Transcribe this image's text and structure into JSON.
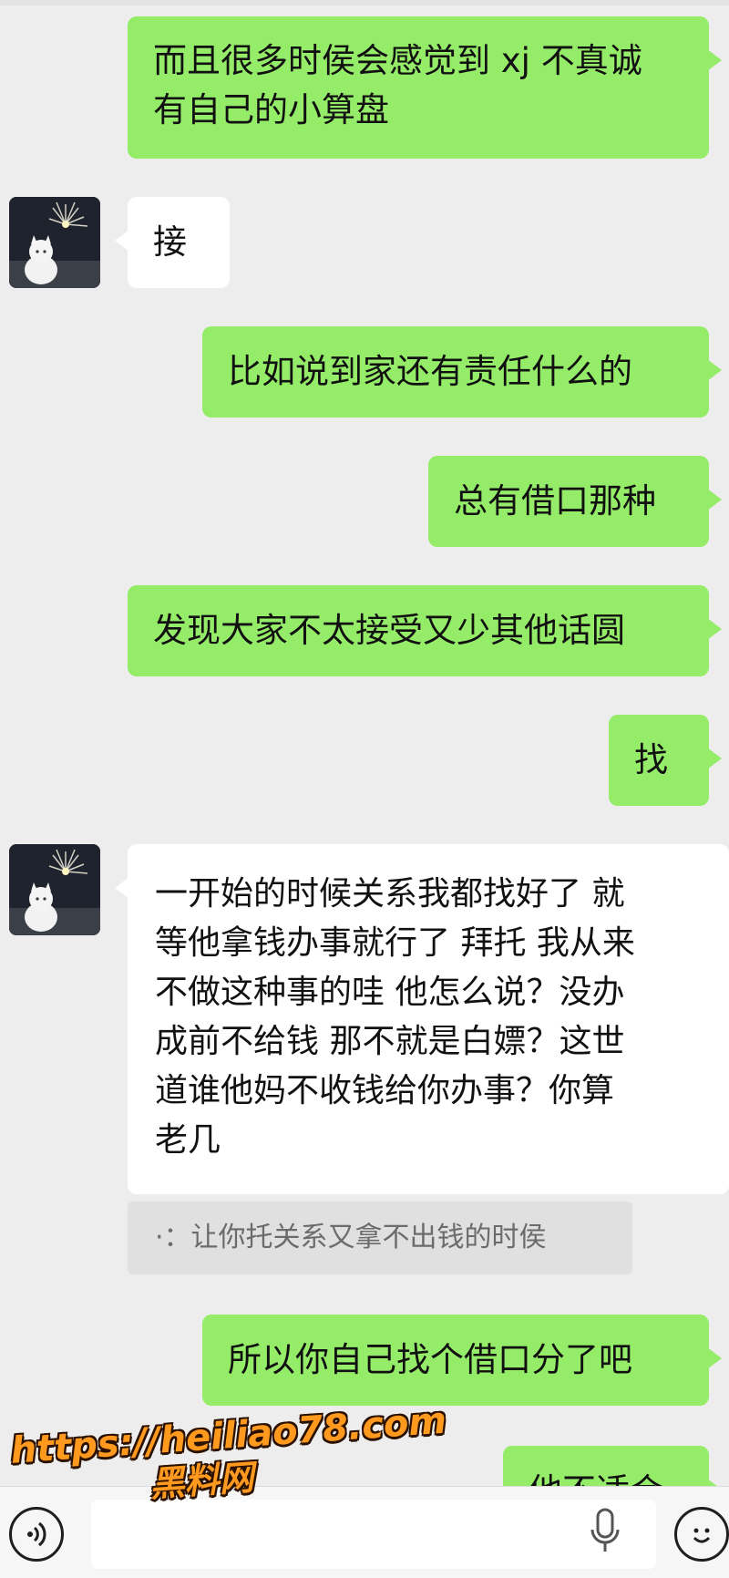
{
  "messages": [
    {
      "side": "me",
      "text": "而且很多时侯会感觉到 xj 不真诚\n有自己的小算盘"
    },
    {
      "side": "them",
      "text": "接"
    },
    {
      "side": "me",
      "text": "比如说到家还有责任什么的"
    },
    {
      "side": "me",
      "text": "总有借口那种"
    },
    {
      "side": "me",
      "text": "发现大家不太接受又少其他话圆"
    },
    {
      "side": "me",
      "text": "找"
    },
    {
      "side": "them",
      "text": "一开始的时候关系我都找好了 就\n等他拿钱办事就行了 拜托 我从来\n不做这种事的哇 他怎么说？没办\n成前不给钱 那不就是白嫖？这世\n道谁他妈不收钱给你办事？你算\n老几"
    },
    {
      "side": "quote",
      "text": "·：让你托关系又拿不出钱的时侯"
    },
    {
      "side": "me",
      "text": "所以你自己找个借口分了吧"
    },
    {
      "side": "me",
      "text": "他不适合"
    }
  ],
  "watermark": {
    "url": "https://heiliao78.com",
    "name": "黑料网"
  },
  "input_bar": {
    "voice_icon": "voice-wave-icon",
    "mic_icon": "microphone-icon",
    "emoji_icon": "emoji-face-icon",
    "text_value": ""
  },
  "colors": {
    "my_bubble": "#95ec69",
    "their_bubble": "#ffffff",
    "background": "#ededed",
    "watermark": "#ff9a1f"
  }
}
